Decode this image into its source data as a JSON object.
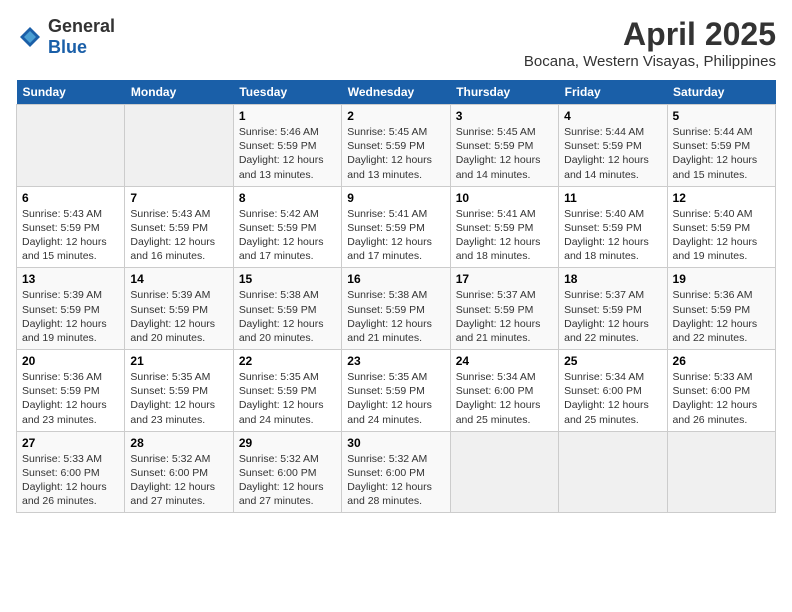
{
  "header": {
    "logo_general": "General",
    "logo_blue": "Blue",
    "month_year": "April 2025",
    "location": "Bocana, Western Visayas, Philippines"
  },
  "weekdays": [
    "Sunday",
    "Monday",
    "Tuesday",
    "Wednesday",
    "Thursday",
    "Friday",
    "Saturday"
  ],
  "weeks": [
    [
      {
        "day": "",
        "sunrise": "",
        "sunset": "",
        "daylight": "",
        "empty": true
      },
      {
        "day": "",
        "sunrise": "",
        "sunset": "",
        "daylight": "",
        "empty": true
      },
      {
        "day": "1",
        "sunrise": "Sunrise: 5:46 AM",
        "sunset": "Sunset: 5:59 PM",
        "daylight": "Daylight: 12 hours and 13 minutes.",
        "empty": false
      },
      {
        "day": "2",
        "sunrise": "Sunrise: 5:45 AM",
        "sunset": "Sunset: 5:59 PM",
        "daylight": "Daylight: 12 hours and 13 minutes.",
        "empty": false
      },
      {
        "day": "3",
        "sunrise": "Sunrise: 5:45 AM",
        "sunset": "Sunset: 5:59 PM",
        "daylight": "Daylight: 12 hours and 14 minutes.",
        "empty": false
      },
      {
        "day": "4",
        "sunrise": "Sunrise: 5:44 AM",
        "sunset": "Sunset: 5:59 PM",
        "daylight": "Daylight: 12 hours and 14 minutes.",
        "empty": false
      },
      {
        "day": "5",
        "sunrise": "Sunrise: 5:44 AM",
        "sunset": "Sunset: 5:59 PM",
        "daylight": "Daylight: 12 hours and 15 minutes.",
        "empty": false
      }
    ],
    [
      {
        "day": "6",
        "sunrise": "Sunrise: 5:43 AM",
        "sunset": "Sunset: 5:59 PM",
        "daylight": "Daylight: 12 hours and 15 minutes.",
        "empty": false
      },
      {
        "day": "7",
        "sunrise": "Sunrise: 5:43 AM",
        "sunset": "Sunset: 5:59 PM",
        "daylight": "Daylight: 12 hours and 16 minutes.",
        "empty": false
      },
      {
        "day": "8",
        "sunrise": "Sunrise: 5:42 AM",
        "sunset": "Sunset: 5:59 PM",
        "daylight": "Daylight: 12 hours and 17 minutes.",
        "empty": false
      },
      {
        "day": "9",
        "sunrise": "Sunrise: 5:41 AM",
        "sunset": "Sunset: 5:59 PM",
        "daylight": "Daylight: 12 hours and 17 minutes.",
        "empty": false
      },
      {
        "day": "10",
        "sunrise": "Sunrise: 5:41 AM",
        "sunset": "Sunset: 5:59 PM",
        "daylight": "Daylight: 12 hours and 18 minutes.",
        "empty": false
      },
      {
        "day": "11",
        "sunrise": "Sunrise: 5:40 AM",
        "sunset": "Sunset: 5:59 PM",
        "daylight": "Daylight: 12 hours and 18 minutes.",
        "empty": false
      },
      {
        "day": "12",
        "sunrise": "Sunrise: 5:40 AM",
        "sunset": "Sunset: 5:59 PM",
        "daylight": "Daylight: 12 hours and 19 minutes.",
        "empty": false
      }
    ],
    [
      {
        "day": "13",
        "sunrise": "Sunrise: 5:39 AM",
        "sunset": "Sunset: 5:59 PM",
        "daylight": "Daylight: 12 hours and 19 minutes.",
        "empty": false
      },
      {
        "day": "14",
        "sunrise": "Sunrise: 5:39 AM",
        "sunset": "Sunset: 5:59 PM",
        "daylight": "Daylight: 12 hours and 20 minutes.",
        "empty": false
      },
      {
        "day": "15",
        "sunrise": "Sunrise: 5:38 AM",
        "sunset": "Sunset: 5:59 PM",
        "daylight": "Daylight: 12 hours and 20 minutes.",
        "empty": false
      },
      {
        "day": "16",
        "sunrise": "Sunrise: 5:38 AM",
        "sunset": "Sunset: 5:59 PM",
        "daylight": "Daylight: 12 hours and 21 minutes.",
        "empty": false
      },
      {
        "day": "17",
        "sunrise": "Sunrise: 5:37 AM",
        "sunset": "Sunset: 5:59 PM",
        "daylight": "Daylight: 12 hours and 21 minutes.",
        "empty": false
      },
      {
        "day": "18",
        "sunrise": "Sunrise: 5:37 AM",
        "sunset": "Sunset: 5:59 PM",
        "daylight": "Daylight: 12 hours and 22 minutes.",
        "empty": false
      },
      {
        "day": "19",
        "sunrise": "Sunrise: 5:36 AM",
        "sunset": "Sunset: 5:59 PM",
        "daylight": "Daylight: 12 hours and 22 minutes.",
        "empty": false
      }
    ],
    [
      {
        "day": "20",
        "sunrise": "Sunrise: 5:36 AM",
        "sunset": "Sunset: 5:59 PM",
        "daylight": "Daylight: 12 hours and 23 minutes.",
        "empty": false
      },
      {
        "day": "21",
        "sunrise": "Sunrise: 5:35 AM",
        "sunset": "Sunset: 5:59 PM",
        "daylight": "Daylight: 12 hours and 23 minutes.",
        "empty": false
      },
      {
        "day": "22",
        "sunrise": "Sunrise: 5:35 AM",
        "sunset": "Sunset: 5:59 PM",
        "daylight": "Daylight: 12 hours and 24 minutes.",
        "empty": false
      },
      {
        "day": "23",
        "sunrise": "Sunrise: 5:35 AM",
        "sunset": "Sunset: 5:59 PM",
        "daylight": "Daylight: 12 hours and 24 minutes.",
        "empty": false
      },
      {
        "day": "24",
        "sunrise": "Sunrise: 5:34 AM",
        "sunset": "Sunset: 6:00 PM",
        "daylight": "Daylight: 12 hours and 25 minutes.",
        "empty": false
      },
      {
        "day": "25",
        "sunrise": "Sunrise: 5:34 AM",
        "sunset": "Sunset: 6:00 PM",
        "daylight": "Daylight: 12 hours and 25 minutes.",
        "empty": false
      },
      {
        "day": "26",
        "sunrise": "Sunrise: 5:33 AM",
        "sunset": "Sunset: 6:00 PM",
        "daylight": "Daylight: 12 hours and 26 minutes.",
        "empty": false
      }
    ],
    [
      {
        "day": "27",
        "sunrise": "Sunrise: 5:33 AM",
        "sunset": "Sunset: 6:00 PM",
        "daylight": "Daylight: 12 hours and 26 minutes.",
        "empty": false
      },
      {
        "day": "28",
        "sunrise": "Sunrise: 5:32 AM",
        "sunset": "Sunset: 6:00 PM",
        "daylight": "Daylight: 12 hours and 27 minutes.",
        "empty": false
      },
      {
        "day": "29",
        "sunrise": "Sunrise: 5:32 AM",
        "sunset": "Sunset: 6:00 PM",
        "daylight": "Daylight: 12 hours and 27 minutes.",
        "empty": false
      },
      {
        "day": "30",
        "sunrise": "Sunrise: 5:32 AM",
        "sunset": "Sunset: 6:00 PM",
        "daylight": "Daylight: 12 hours and 28 minutes.",
        "empty": false
      },
      {
        "day": "",
        "sunrise": "",
        "sunset": "",
        "daylight": "",
        "empty": true
      },
      {
        "day": "",
        "sunrise": "",
        "sunset": "",
        "daylight": "",
        "empty": true
      },
      {
        "day": "",
        "sunrise": "",
        "sunset": "",
        "daylight": "",
        "empty": true
      }
    ]
  ]
}
